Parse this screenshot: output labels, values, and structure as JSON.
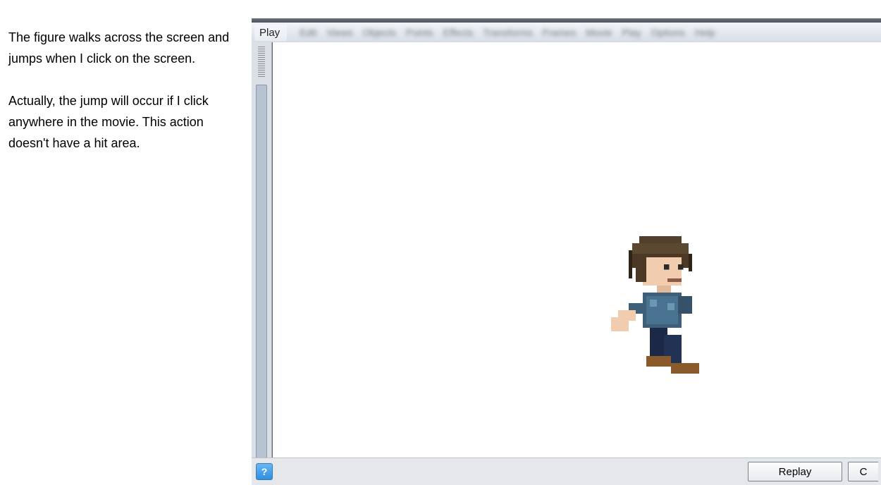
{
  "description": {
    "p1": "The figure walks across the screen and jumps when I click on the screen.",
    "p2": "Actually, the jump will occur if I click anywhere in the movie. This action doesn't have a hit area."
  },
  "app": {
    "menu": {
      "play": "Play",
      "blurred": [
        "Edit",
        "Views",
        "Objects",
        "Points",
        "Effects",
        "Transforms",
        "Frames",
        "Movie",
        "Play",
        "Options",
        "Help"
      ]
    },
    "bottom": {
      "help_glyph": "?",
      "replay": "Replay",
      "close_initial": "C"
    }
  }
}
